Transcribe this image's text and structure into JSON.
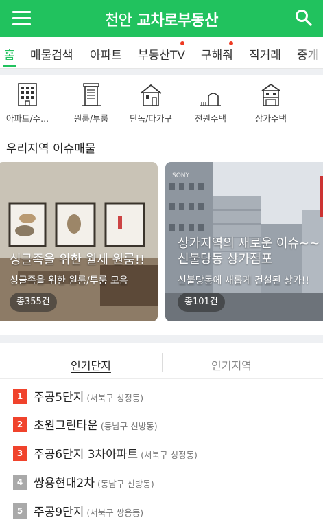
{
  "header": {
    "brand_part1": "천안",
    "brand_part2": "교차로부동산",
    "menu_icon": "hamburger-menu-icon",
    "search_icon": "search-icon",
    "background_color": "#21c25e"
  },
  "tabs": [
    {
      "label": "홈",
      "active": true,
      "new_dot": false
    },
    {
      "label": "매물검색",
      "active": false,
      "new_dot": false
    },
    {
      "label": "아파트",
      "active": false,
      "new_dot": false
    },
    {
      "label": "부동산TV",
      "active": false,
      "new_dot": true
    },
    {
      "label": "구해줘",
      "active": false,
      "new_dot": true
    },
    {
      "label": "직거래",
      "active": false,
      "new_dot": false
    },
    {
      "label": "중개",
      "active": false,
      "new_dot": false
    }
  ],
  "categories": [
    {
      "label": "아파트/주...",
      "icon": "apartment-building-icon"
    },
    {
      "label": "원룸/투룸",
      "icon": "studio-building-icon"
    },
    {
      "label": "단독/다가구",
      "icon": "house-icon"
    },
    {
      "label": "전원주택",
      "icon": "country-house-icon"
    },
    {
      "label": "상가주택",
      "icon": "commercial-house-icon"
    }
  ],
  "issue_section": {
    "title": "우리지역 이슈매물",
    "cards": [
      {
        "title": "싱글족을 위한 월세 원룸!!",
        "subtitle": "싱글족을 위한 원룸/투룸 모음",
        "count": "총355건"
      },
      {
        "title_line1": "상가지역의 새로운 이슈~~",
        "title_line2": "신불당동 상가점포",
        "subtitle": "신불당동에 새롭게 건설된 상가!!",
        "count": "총101건"
      }
    ]
  },
  "popular": {
    "tabs": [
      {
        "label": "인기단지",
        "active": true
      },
      {
        "label": "인기지역",
        "active": false
      }
    ],
    "items": [
      {
        "rank": "1",
        "name": "주공5단지",
        "location": "(서북구 성정동)",
        "badge_color": "#f0432c"
      },
      {
        "rank": "2",
        "name": "초원그린타운",
        "location": "(동남구 신방동)",
        "badge_color": "#f0432c"
      },
      {
        "rank": "3",
        "name": "주공6단지 3차아파트",
        "location": "(서북구 성정동)",
        "badge_color": "#f0432c"
      },
      {
        "rank": "4",
        "name": "쌍용현대2차",
        "location": "(동남구 신방동)",
        "badge_color": "#a9a9a9"
      },
      {
        "rank": "5",
        "name": "주공9단지",
        "location": "(서북구 쌍용동)",
        "badge_color": "#a9a9a9"
      }
    ]
  },
  "colors": {
    "accent": "#21c25e",
    "notification_dot": "#ee3a22",
    "rank_top": "#f0432c",
    "rank_other": "#a9a9a9"
  }
}
